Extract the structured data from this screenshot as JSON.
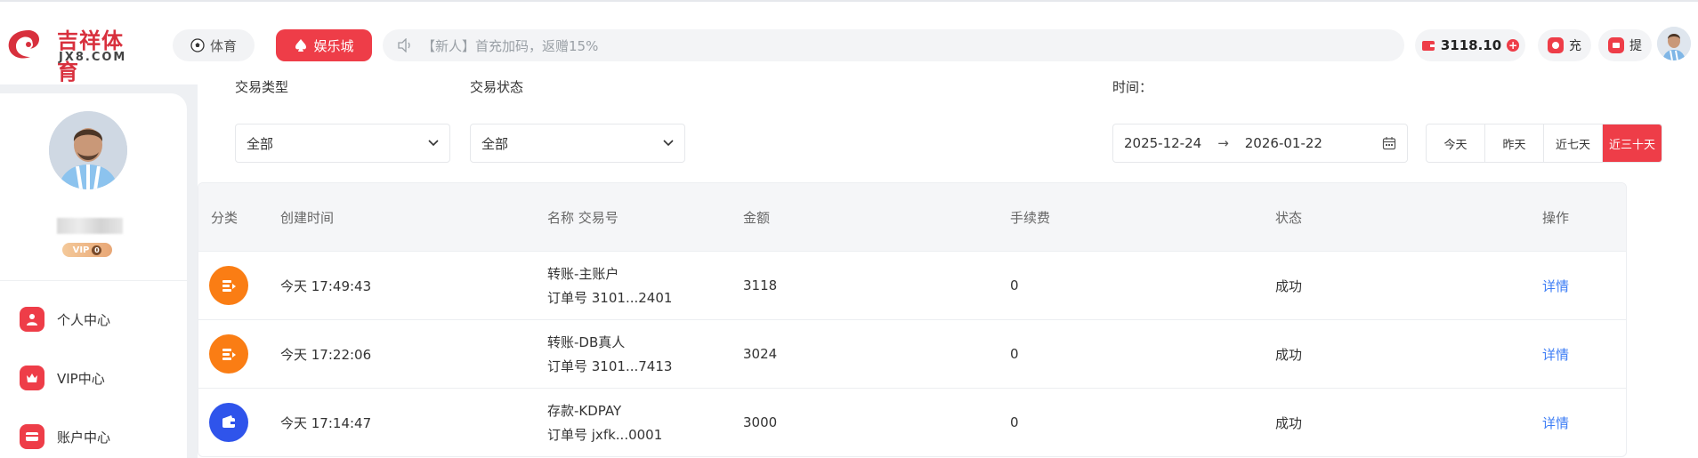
{
  "header": {
    "logo_cn": "吉祥体育",
    "logo_en": "JX8.COM",
    "nav_sport": "体育",
    "nav_entertainment": "娱乐城",
    "announcement": "【新人】首充加码，返赠15%",
    "balance": "3118.10",
    "deposit_label": "充",
    "withdraw_label": "提",
    "icons": {
      "sport": "soccer-ball-icon",
      "entertainment": "spade-icon",
      "announcement": "speaker-icon",
      "balance": "wallet-icon",
      "deposit": "deposit-icon",
      "withdraw": "withdraw-icon"
    }
  },
  "sidebar": {
    "vip_level": "0",
    "vip_text": "VIP",
    "items": [
      {
        "label": "个人中心",
        "icon": "user-icon"
      },
      {
        "label": "VIP中心",
        "icon": "crown-icon"
      },
      {
        "label": "账户中心",
        "icon": "card-icon"
      }
    ]
  },
  "filters": {
    "type_label": "交易类型",
    "type_value": "全部",
    "status_label": "交易状态",
    "status_value": "全部",
    "time_label": "时间：",
    "date_start": "2025-12-24",
    "date_arrow": "→",
    "date_end": "2026-01-22",
    "quick_ranges": [
      "今天",
      "昨天",
      "近七天",
      "近三十天"
    ],
    "quick_selected": "近三十天"
  },
  "table": {
    "headers": [
      "分类",
      "创建时间",
      "名称 交易号",
      "金额",
      "手续费",
      "状态",
      "操作"
    ],
    "rows": [
      {
        "icon": "transfer-icon",
        "icon_color": "#fa7d14",
        "time": "今天 17:49:43",
        "name": "转账-主账户",
        "order": "订单号 3101...2401",
        "amount": "3118",
        "fee": "0",
        "status": "成功",
        "action": "详情"
      },
      {
        "icon": "transfer-icon",
        "icon_color": "#fa7d14",
        "time": "今天 17:22:06",
        "name": "转账-DB真人",
        "order": "订单号 3101...7413",
        "amount": "3024",
        "fee": "0",
        "status": "成功",
        "action": "详情"
      },
      {
        "icon": "wallet-icon",
        "icon_color": "#2f54eb",
        "time": "今天 17:14:47",
        "name": "存款-KDPAY",
        "order": "订单号 jxfk...0001",
        "amount": "3000",
        "fee": "0",
        "status": "成功",
        "action": "详情"
      }
    ]
  },
  "colors": {
    "accent": "#ee3d48",
    "link": "#3d7df5"
  }
}
